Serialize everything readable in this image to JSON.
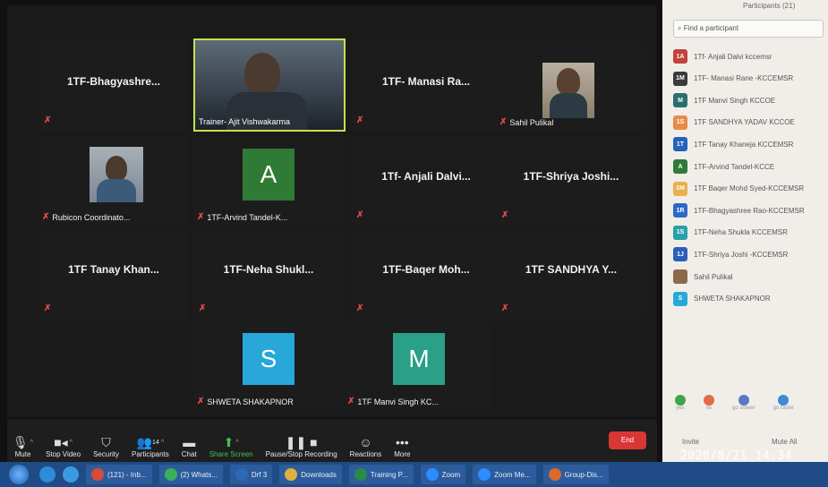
{
  "panel": {
    "title": "Participants (21)",
    "search_placeholder": "Find a participant",
    "participants": [
      {
        "initials": "1A",
        "name": "1Tf- Anjali Dalvi kccemsr",
        "color": "#c0443b"
      },
      {
        "initials": "1M",
        "name": "1TF- Manasi Rane -KCCEMSR",
        "color": "#3a3a3a"
      },
      {
        "initials": "M",
        "name": "1TF Manvi Singh KCCOE",
        "color": "#2a6f6f"
      },
      {
        "initials": "1S",
        "name": "1TF SANDHYA YADAV KCCOE",
        "color": "#e98a4b"
      },
      {
        "initials": "1T",
        "name": "1TF Tanay Khaneja KCCEMSR",
        "color": "#2462b8"
      },
      {
        "initials": "A",
        "name": "1TF-Arvind Tandel-KCCE",
        "color": "#2e7a3a"
      },
      {
        "initials": "1M",
        "name": "1TF Baqer Mohd Syed-KCCEMSR",
        "color": "#e8b04e"
      },
      {
        "initials": "1R",
        "name": "1TF-Bhagyashree Rao-KCCEMSR",
        "color": "#2e68c8"
      },
      {
        "initials": "1S",
        "name": "1TF-Neha Shukla KCCEMSR",
        "color": "#2aa0a8"
      },
      {
        "initials": "1J",
        "name": "1TF-Shriya Joshi -KCCEMSR",
        "color": "#2a5fb8"
      },
      {
        "initials": "",
        "name": "Sahil Pulikal",
        "color": "#8a6a4a"
      },
      {
        "initials": "S",
        "name": "SHWETA SHAKAPNOR",
        "color": "#27a8d8"
      }
    ],
    "reactions": [
      {
        "label": "yes",
        "color": "#3ea64a"
      },
      {
        "label": "no",
        "color": "#e06a4b"
      },
      {
        "label": "go slower",
        "color": "#5a78c8"
      },
      {
        "label": "go faster",
        "color": "#3a8ad8"
      }
    ],
    "invite": "Invite",
    "mute_all": "Mute All"
  },
  "tiles": {
    "bhagyashree": "1TF-Bhagyashre...",
    "trainer": "Trainer- Ajit Vishwakarma",
    "manasi": "1TF- Manasi Ra...",
    "sahil": "Sahil Pulikal",
    "rubicon": "Rubicon Coordinato...",
    "arvind_letter": "A",
    "arvind": "1TF-Arvind Tandel-K...",
    "anjali": "1Tf- Anjali Dalvi...",
    "shriya": "1TF-Shriya Joshi...",
    "tanay": "1TF Tanay Khan...",
    "neha": "1TF-Neha Shukl...",
    "baqer": "1TF-Baqer Moh...",
    "sandhya": "1TF SANDHYA Y...",
    "shweta_letter": "S",
    "shweta": "SHWETA SHAKAPNOR",
    "manvi_letter": "M",
    "manvi": "1TF Manvi Singh KC..."
  },
  "toolbar": {
    "mute": "Mute",
    "stop_video": "Stop Video",
    "security": "Security",
    "participants": "Participants",
    "participants_count": "14",
    "chat": "Chat",
    "share_screen": "Share Screen",
    "recording": "Pause/Stop Recording",
    "reactions": "Reactions",
    "more": "More",
    "end": "End"
  },
  "clock": "2020/8/21  14:34",
  "taskbar": {
    "items": [
      "(121) - Inb...",
      "(2) Whats...",
      "Drf 3",
      "Downloads",
      "Training P...",
      "Zoom",
      "Zoom Me...",
      "Group-Dis..."
    ]
  }
}
